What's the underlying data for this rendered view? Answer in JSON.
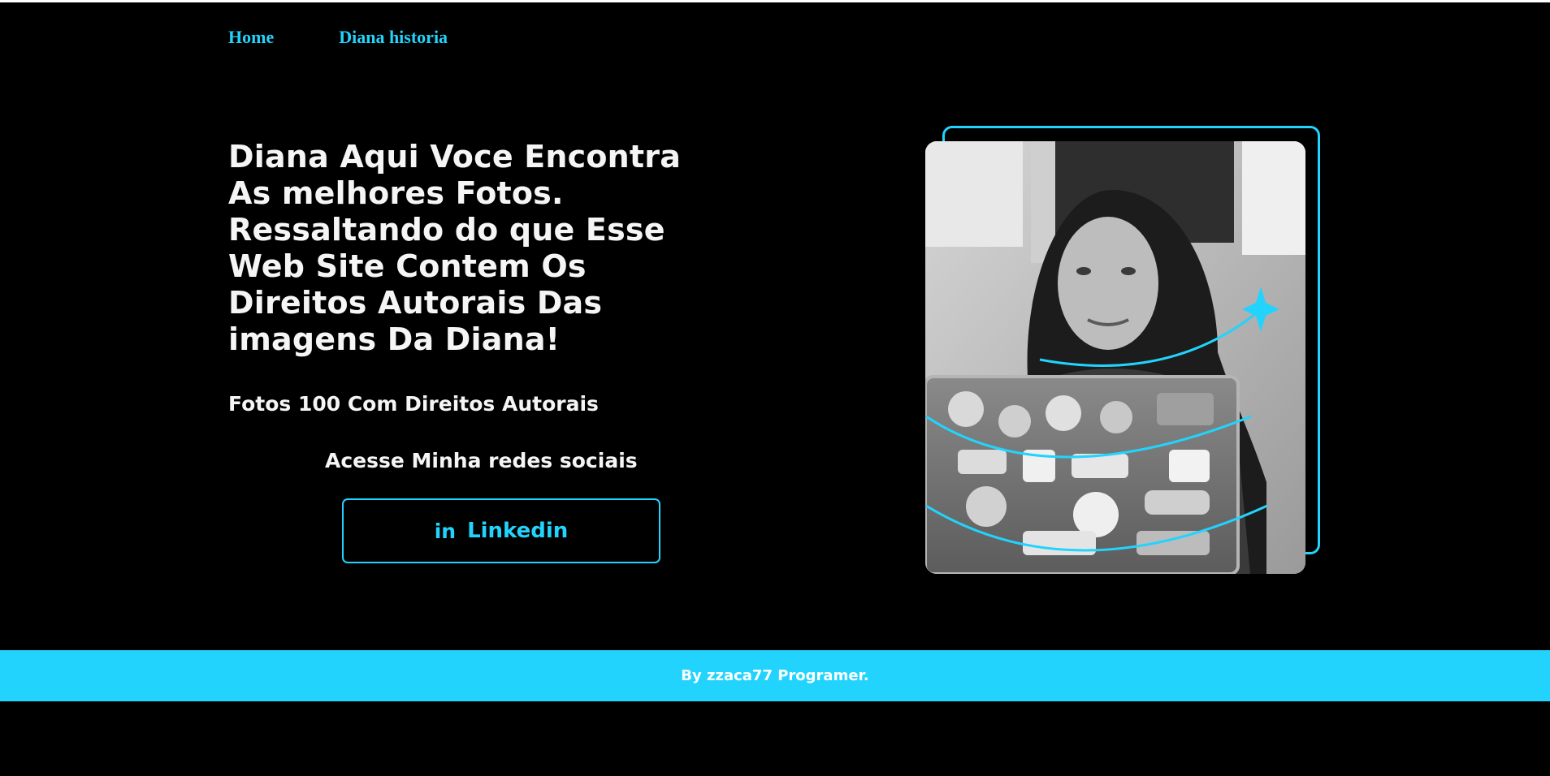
{
  "nav": {
    "items": [
      {
        "label": "Home"
      },
      {
        "label": "Diana historia"
      }
    ]
  },
  "hero": {
    "headline_lines": [
      "Diana Aqui Voce Encontra",
      "As melhores Fotos.",
      "Ressaltando do que Esse",
      "Web Site Contem Os",
      "Direitos Autorais Das",
      "imagens Da Diana!"
    ],
    "subtitle": "Fotos 100 Com Direitos Autorais",
    "social_label": "Acesse Minha redes sociais",
    "linkedin_label": "Linkedin",
    "linkedin_icon": "in"
  },
  "footer": {
    "text": "By zzaca77 Programer."
  },
  "colors": {
    "accent": "#22d4fd",
    "background": "#000000",
    "text": "#f5f5f5"
  },
  "icons": {
    "linkedin": "linkedin-icon",
    "sparkle": "sparkle-icon"
  }
}
